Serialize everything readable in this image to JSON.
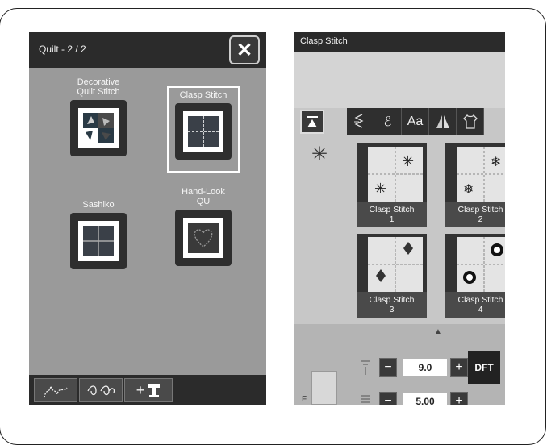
{
  "left_screen": {
    "title": "Quilt - 2 / 2",
    "close_glyph": "✕",
    "tiles": [
      {
        "label": "Decorative\nQuilt Stitch",
        "icon": "decorative-quilt-icon"
      },
      {
        "label": "Clasp Stitch",
        "icon": "clasp-stitch-icon",
        "selected": true
      },
      {
        "label": "Sashiko",
        "icon": "sashiko-icon"
      },
      {
        "label": "Hand-Look\nQU",
        "icon": "hand-look-quilt-icon"
      }
    ],
    "bottom_buttons": [
      {
        "icon": "stipple-icon"
      },
      {
        "icon": "flower-border-icon"
      },
      {
        "label": "+",
        "icon": "add-presser-foot-icon"
      }
    ]
  },
  "right_screen": {
    "title": "Clasp Stitch",
    "category_tabs": [
      {
        "icon": "stitch-selection-icon"
      },
      {
        "icon": "zigzag-icon"
      },
      {
        "icon": "pattern-icon"
      },
      {
        "label": "Aa"
      },
      {
        "icon": "mirror-icon"
      },
      {
        "icon": "shirt-icon"
      }
    ],
    "side_icon": "asterisk-icon",
    "stitches": [
      {
        "label_line1": "Clasp Stitch",
        "label_line2": "1",
        "motif": "✳"
      },
      {
        "label_line1": "Clasp Stitch",
        "label_line2": "2",
        "motif": "❄"
      },
      {
        "label_line1": "Clasp Stitch",
        "label_line2": "3",
        "motif": "◆"
      },
      {
        "label_line1": "Clasp Stitch",
        "label_line2": "4",
        "motif": "✺"
      }
    ],
    "stitch_width": "9.0",
    "stitch_length": "5.00",
    "dft_label": "DFT",
    "foot_letter": "F",
    "up_arrow": "▲"
  },
  "colors": {
    "screen_left_bg": "#9a9a9a",
    "screen_right_bg": "#c7c7c7",
    "header_bg": "#2b2b2b",
    "stitch_card_dark": "#333333"
  }
}
